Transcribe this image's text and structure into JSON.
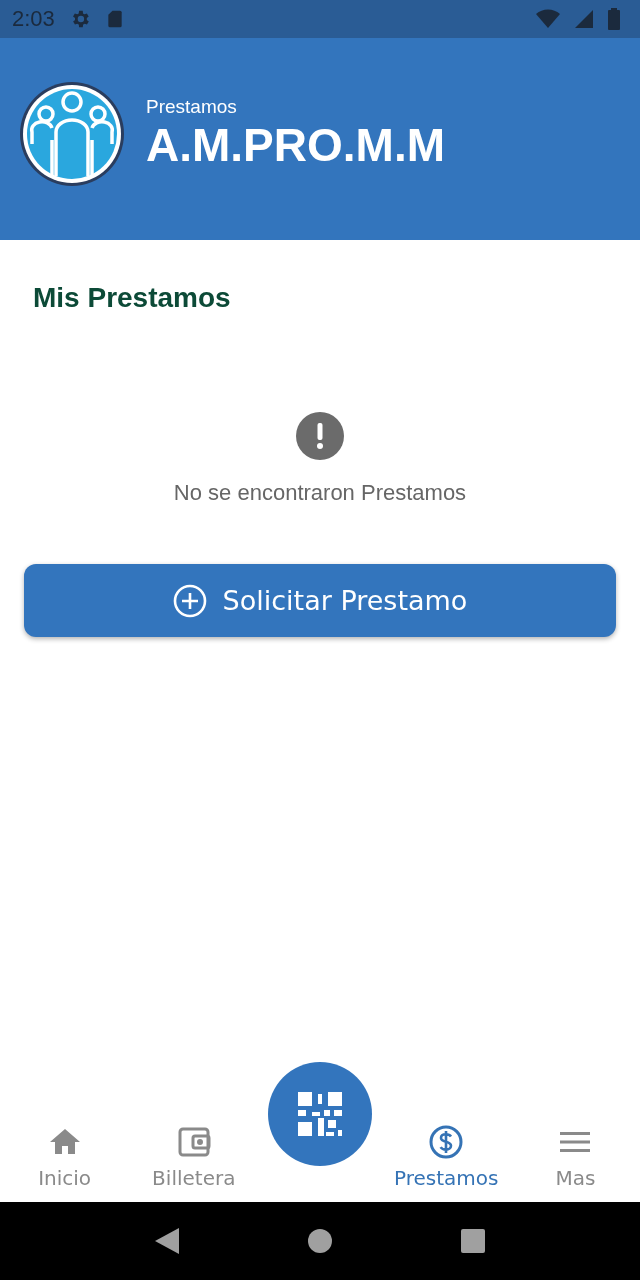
{
  "status_bar": {
    "time": "2:03"
  },
  "header": {
    "subtitle": "Prestamos",
    "title": "A.M.PRO.M.M"
  },
  "section": {
    "title": "Mis Prestamos"
  },
  "empty_state": {
    "message": "No se encontraron Prestamos"
  },
  "action_button": {
    "label": "Solicitar Prestamo"
  },
  "bottom_nav": {
    "items": [
      {
        "kind": "home",
        "label": "Inicio",
        "selected": false
      },
      {
        "kind": "wallet",
        "label": "Billetera",
        "selected": false
      },
      {
        "kind": "loan",
        "label": "Prestamos",
        "selected": true
      },
      {
        "kind": "menu",
        "label": "Mas",
        "selected": false
      }
    ]
  }
}
